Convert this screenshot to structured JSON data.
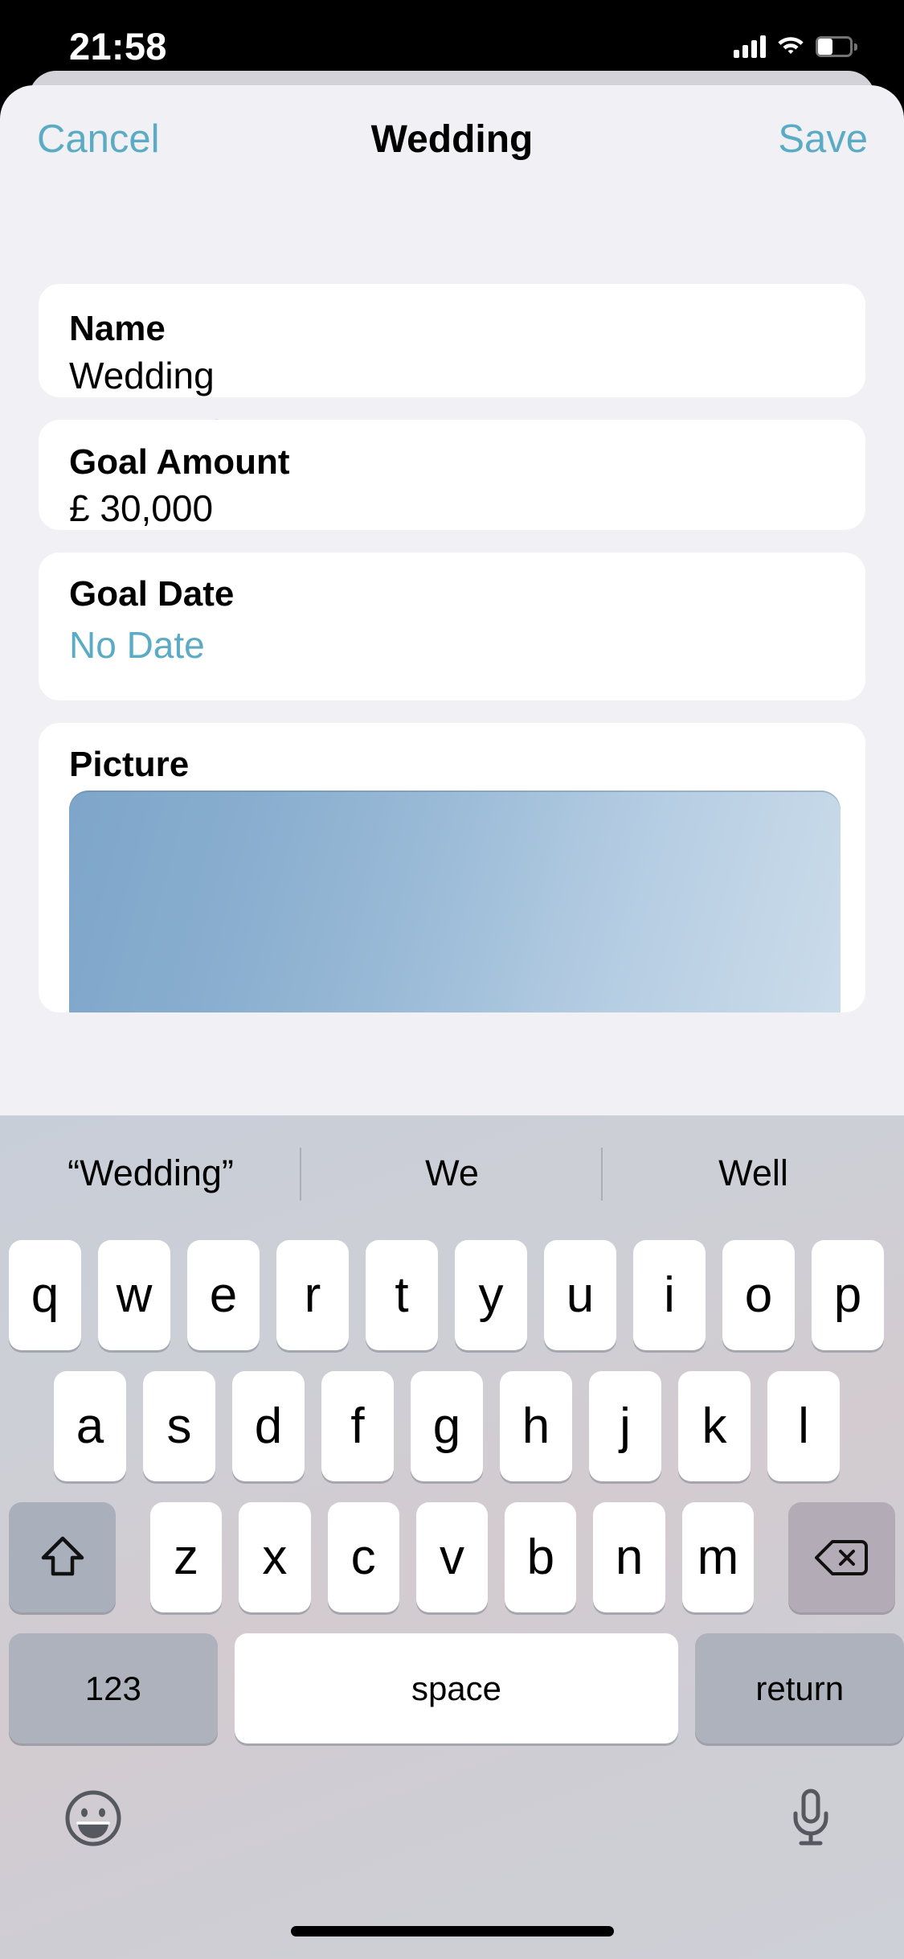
{
  "status_bar": {
    "time": "21:58",
    "cellular_icon": "cellular-bars-icon",
    "wifi_icon": "wifi-icon",
    "battery_icon": "battery-icon"
  },
  "nav": {
    "cancel_label": "Cancel",
    "title": "Wedding",
    "save_label": "Save"
  },
  "form": {
    "name": {
      "label": "Name",
      "value": "Wedding",
      "clear_icon": "clear-circle-icon"
    },
    "goal_amount": {
      "label": "Goal Amount",
      "value": "£ 30,000"
    },
    "goal_date": {
      "label": "Goal Date",
      "value": "No Date"
    },
    "picture": {
      "label": "Picture",
      "thumbnail": "blue-gradient-image"
    }
  },
  "keyboard": {
    "suggestions": [
      "“Wedding”",
      "We",
      "Well"
    ],
    "row1": [
      "q",
      "w",
      "e",
      "r",
      "t",
      "y",
      "u",
      "i",
      "o",
      "p"
    ],
    "row2": [
      "a",
      "s",
      "d",
      "f",
      "g",
      "h",
      "j",
      "k",
      "l"
    ],
    "row3_letters": [
      "z",
      "x",
      "c",
      "v",
      "b",
      "n",
      "m"
    ],
    "shift_icon": "shift-arrow-icon",
    "delete_icon": "backspace-delete-icon",
    "numbers_label": "123",
    "space_label": "space",
    "return_label": "return",
    "emoji_icon": "emoji-smiley-icon",
    "mic_icon": "microphone-icon"
  },
  "colors": {
    "accent_teal": "#5aabc3",
    "sheet_background": "#f1f1f5",
    "card_background": "#ffffff",
    "keyboard_background": "#ced2da",
    "key_white": "#ffffff",
    "key_gray": "#adb2bd",
    "clear_button_gray": "#cbcbcd",
    "caret_teal": "#cde6ee"
  }
}
